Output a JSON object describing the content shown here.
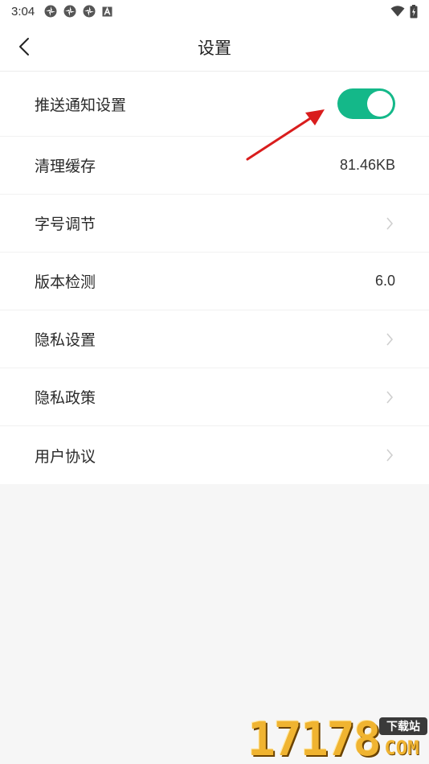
{
  "status_bar": {
    "time": "3:04",
    "icons": [
      "app-notification-icon",
      "app-notification-icon",
      "app-notification-icon",
      "a-icon"
    ],
    "right_icons": [
      "wifi-icon",
      "battery-icon"
    ]
  },
  "header": {
    "title": "设置",
    "back_icon": "chevron-left-icon"
  },
  "settings": {
    "push": {
      "label": "推送通知设置",
      "toggle_on": true,
      "accent": "#14b889"
    },
    "cache": {
      "label": "清理缓存",
      "value": "81.46KB"
    },
    "font_size": {
      "label": "字号调节"
    },
    "version": {
      "label": "版本检测",
      "value": "6.0"
    },
    "privacy_settings": {
      "label": "隐私设置"
    },
    "privacy_policy": {
      "label": "隐私政策"
    },
    "user_agreement": {
      "label": "用户协议"
    }
  },
  "annotation": {
    "color": "#d91d1d",
    "icon": "red-arrow-icon"
  },
  "watermark": {
    "number": "17178",
    "badge": "下载站",
    "suffix": "COM"
  }
}
